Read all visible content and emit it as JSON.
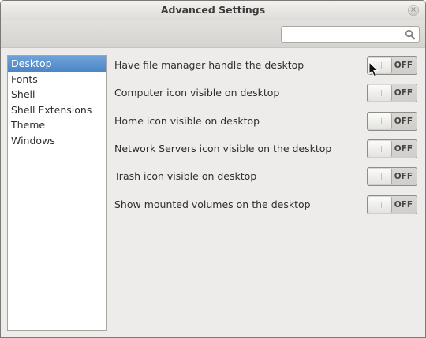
{
  "window": {
    "title": "Advanced Settings",
    "close_label": "×"
  },
  "search": {
    "value": "",
    "placeholder": ""
  },
  "sidebar": {
    "items": [
      {
        "label": "Desktop",
        "selected": true
      },
      {
        "label": "Fonts",
        "selected": false
      },
      {
        "label": "Shell",
        "selected": false
      },
      {
        "label": "Shell Extensions",
        "selected": false
      },
      {
        "label": "Theme",
        "selected": false
      },
      {
        "label": "Windows",
        "selected": false
      }
    ]
  },
  "settings": [
    {
      "label": "Have file manager handle the desktop",
      "state": "OFF"
    },
    {
      "label": "Computer icon visible on desktop",
      "state": "OFF"
    },
    {
      "label": "Home icon visible on desktop",
      "state": "OFF"
    },
    {
      "label": "Network Servers icon visible on the desktop",
      "state": "OFF"
    },
    {
      "label": "Trash icon visible on desktop",
      "state": "OFF"
    },
    {
      "label": "Show mounted volumes on the desktop",
      "state": "OFF"
    }
  ],
  "icons": {
    "search": "search-icon",
    "close": "close-icon",
    "cursor": "mouse-cursor-icon"
  },
  "colors": {
    "selection": "#4c86c6",
    "window_bg": "#edeceb"
  }
}
